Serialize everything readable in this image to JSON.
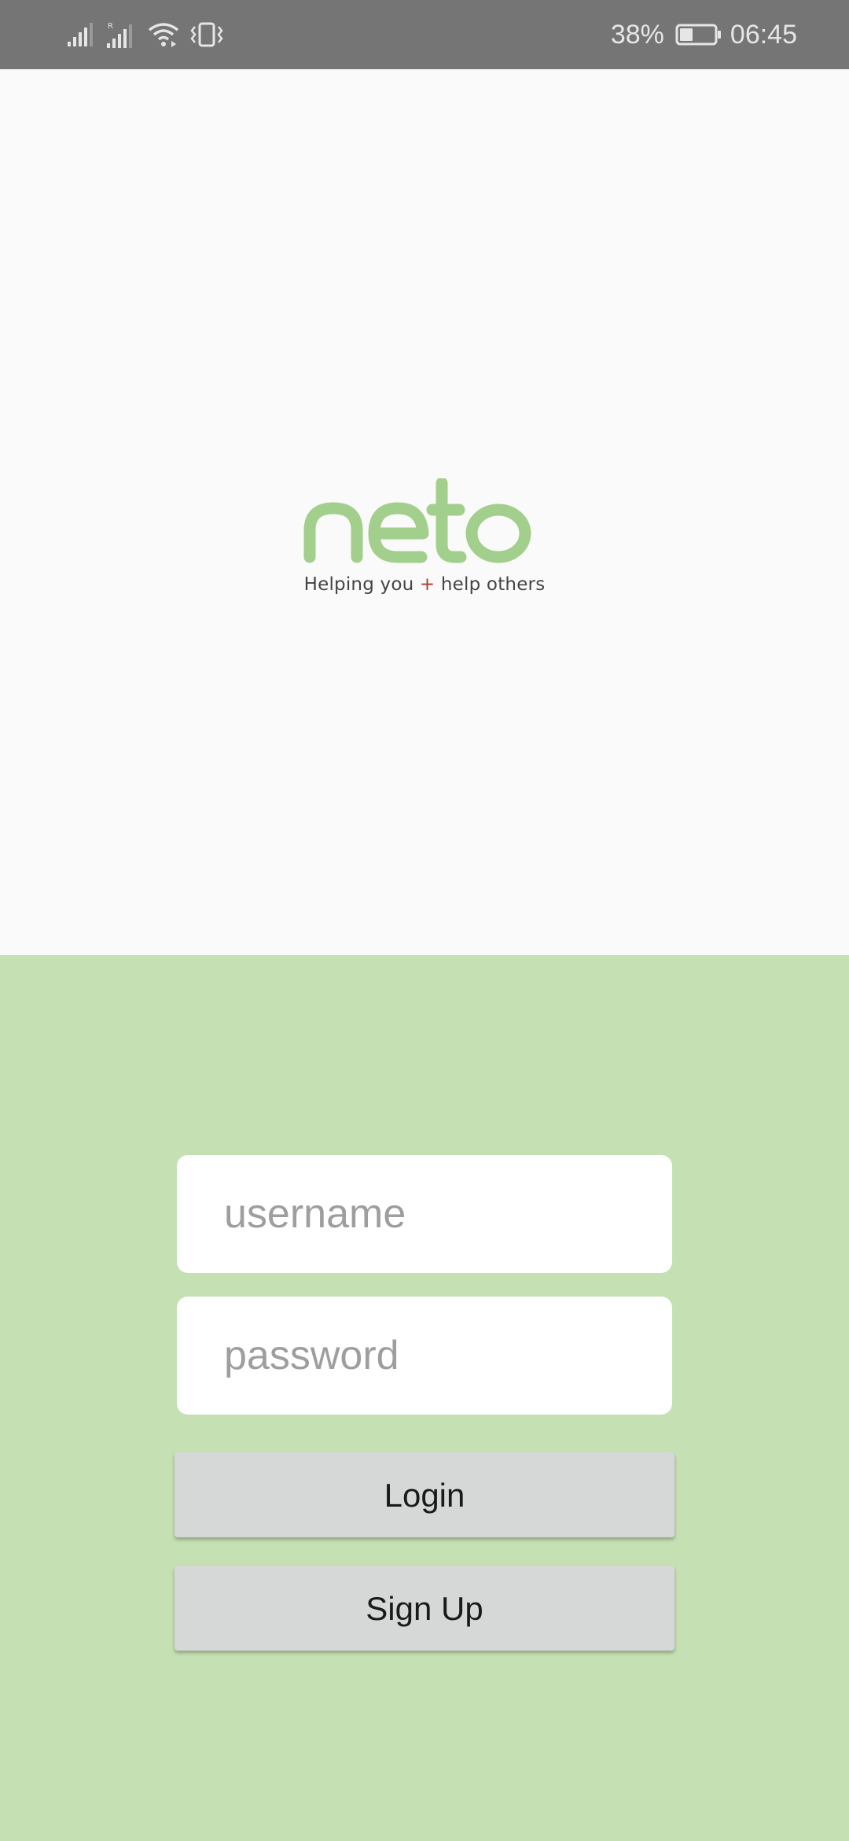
{
  "status_bar": {
    "battery_percent": "38%",
    "time": "06:45",
    "battery_level": 0.38,
    "icons": [
      "signal-icon",
      "signal-roaming-icon",
      "wifi-icon",
      "vibrate-icon",
      "battery-icon"
    ]
  },
  "logo": {
    "wordmark": "neto",
    "tagline_part1": "Helping you ",
    "tagline_plus": "+",
    "tagline_part2": " help others",
    "brand_color": "#a3cf8c",
    "plus_color": "#b03a2e"
  },
  "form": {
    "username_placeholder": "username",
    "password_placeholder": "password",
    "login_label": "Login",
    "signup_label": "Sign Up"
  },
  "colors": {
    "status_bar": "#757575",
    "top_background": "#fafafa",
    "bottom_background": "#c5e1b4",
    "button_background": "#d6d8d7"
  }
}
